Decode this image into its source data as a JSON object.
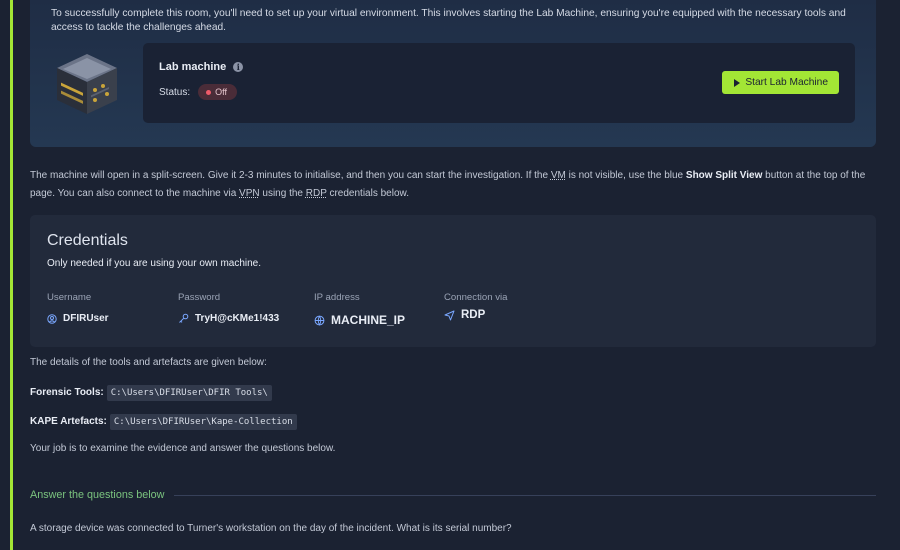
{
  "environment": {
    "intro": "To successfully complete this room, you'll need to set up your virtual environment. This involves starting the Lab Machine, ensuring you're equipped with the necessary tools and access to tackle the challenges ahead.",
    "lab_title": "Lab machine",
    "status_label": "Status:",
    "status_value": "Off",
    "start_button": "Start Lab Machine"
  },
  "split_info": {
    "part1": "The machine will open in a split-screen. Give it 2-3 minutes to initialise, and then you can start the investigation. If the ",
    "vm": "VM",
    "part2": " is not visible, use the blue ",
    "show_split": "Show Split View",
    "part3": " button at the top of the page. You can also connect to the machine via ",
    "vpn": "VPN",
    "part4": " using the ",
    "rdp": "RDP",
    "part5": " credentials below."
  },
  "credentials": {
    "title": "Credentials",
    "subtitle": "Only needed if you are using your own machine.",
    "fields": [
      {
        "label": "Username",
        "value": "DFIRUser",
        "icon": "user-icon"
      },
      {
        "label": "Password",
        "value": "TryH@cKMe1!433",
        "icon": "key-icon"
      },
      {
        "label": "IP address",
        "value": "MACHINE_IP",
        "icon": "network-icon"
      },
      {
        "label": "Connection via",
        "value": "RDP",
        "icon": "send-icon"
      }
    ]
  },
  "tools": {
    "intro": "The details of the tools and artefacts are given below:",
    "forensic_label": "Forensic Tools:",
    "forensic_path": "C:\\Users\\DFIRUser\\DFIR Tools\\",
    "kape_label": "KAPE Artefacts:",
    "kape_path": "C:\\Users\\DFIRUser\\Kape-Collection",
    "job": "Your job is to examine the evidence and answer the questions below."
  },
  "questions": {
    "header": "Answer the questions below",
    "q1": "A storage device was connected to Turner's workstation on the day of the incident. What is its serial number?"
  },
  "colors": {
    "accent": "#a3e635",
    "status_off": "#ef5b6a",
    "section_green": "#7bc47f"
  }
}
